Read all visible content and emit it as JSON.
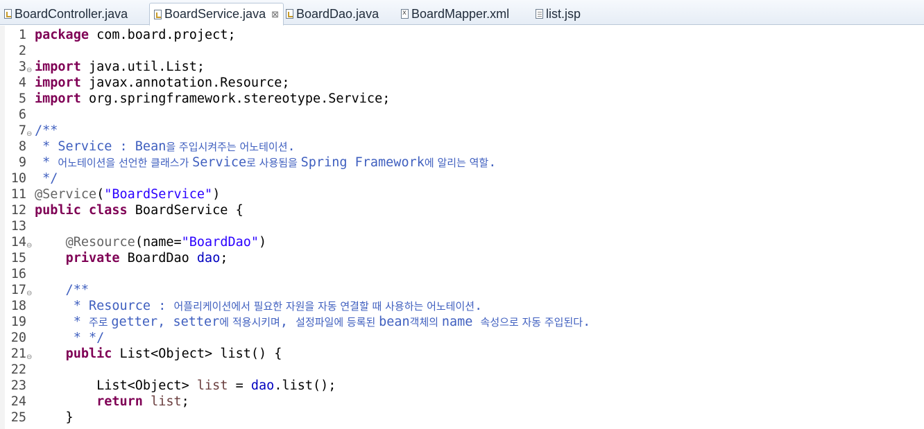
{
  "tabs": [
    {
      "label": "BoardController.java",
      "icon": "java-file-icon",
      "active": false
    },
    {
      "label": "BoardService.java",
      "icon": "java-file-icon",
      "active": true
    },
    {
      "label": "BoardDao.java",
      "icon": "java-file-icon",
      "active": false
    },
    {
      "label": "BoardMapper.xml",
      "icon": "xml-file-icon",
      "active": false
    },
    {
      "label": "list.jsp",
      "icon": "jsp-file-icon",
      "active": false
    }
  ],
  "close_glyph": "⊠",
  "fold_glyph": "⊖",
  "lines": [
    {
      "n": "1",
      "fold": false,
      "t": [
        {
          "c": "kw",
          "s": "package"
        },
        {
          "c": "plain",
          "s": " com.board.project;"
        }
      ]
    },
    {
      "n": "2",
      "fold": false,
      "t": []
    },
    {
      "n": "3",
      "fold": true,
      "t": [
        {
          "c": "kw",
          "s": "import"
        },
        {
          "c": "plain",
          "s": " java.util.List;"
        }
      ]
    },
    {
      "n": "4",
      "fold": false,
      "t": [
        {
          "c": "kw",
          "s": "import"
        },
        {
          "c": "plain",
          "s": " javax.annotation.Resource;"
        }
      ]
    },
    {
      "n": "5",
      "fold": false,
      "t": [
        {
          "c": "kw",
          "s": "import"
        },
        {
          "c": "plain",
          "s": " org.springframework.stereotype.Service;"
        }
      ]
    },
    {
      "n": "6",
      "fold": false,
      "t": []
    },
    {
      "n": "7",
      "fold": true,
      "t": [
        {
          "c": "jdoc",
          "s": "/**"
        }
      ]
    },
    {
      "n": "8",
      "fold": false,
      "t": [
        {
          "c": "jdoc",
          "s": " * Service : Bean"
        },
        {
          "c": "jdoc ko",
          "s": "을 주입시켜주는 어노테이션"
        },
        {
          "c": "jdoc",
          "s": "."
        }
      ]
    },
    {
      "n": "9",
      "fold": false,
      "t": [
        {
          "c": "jdoc",
          "s": " * "
        },
        {
          "c": "jdoc ko",
          "s": "어노테이션을 선언한 클래스가 "
        },
        {
          "c": "jdoc",
          "s": "Service"
        },
        {
          "c": "jdoc ko",
          "s": "로 사용됨을 "
        },
        {
          "c": "jdoc",
          "s": "Spring Framework"
        },
        {
          "c": "jdoc ko",
          "s": "에 알리는 역할"
        },
        {
          "c": "jdoc",
          "s": "."
        }
      ]
    },
    {
      "n": "10",
      "fold": false,
      "t": [
        {
          "c": "jdoc",
          "s": " */"
        }
      ]
    },
    {
      "n": "11",
      "fold": false,
      "t": [
        {
          "c": "ann",
          "s": "@Service"
        },
        {
          "c": "plain",
          "s": "("
        },
        {
          "c": "str",
          "s": "\"BoardService\""
        },
        {
          "c": "plain",
          "s": ")"
        }
      ]
    },
    {
      "n": "12",
      "fold": false,
      "t": [
        {
          "c": "kw",
          "s": "public class"
        },
        {
          "c": "plain",
          "s": " BoardService {"
        }
      ]
    },
    {
      "n": "13",
      "fold": false,
      "t": []
    },
    {
      "n": "14",
      "fold": true,
      "t": [
        {
          "c": "plain",
          "s": "    "
        },
        {
          "c": "ann",
          "s": "@Resource"
        },
        {
          "c": "plain",
          "s": "(name="
        },
        {
          "c": "str",
          "s": "\"BoardDao\""
        },
        {
          "c": "plain",
          "s": ")"
        }
      ]
    },
    {
      "n": "15",
      "fold": false,
      "t": [
        {
          "c": "plain",
          "s": "    "
        },
        {
          "c": "kw",
          "s": "private"
        },
        {
          "c": "plain",
          "s": " BoardDao "
        },
        {
          "c": "field",
          "s": "dao"
        },
        {
          "c": "plain",
          "s": ";"
        }
      ]
    },
    {
      "n": "16",
      "fold": false,
      "t": []
    },
    {
      "n": "17",
      "fold": true,
      "t": [
        {
          "c": "jdoc",
          "s": "    /**"
        }
      ]
    },
    {
      "n": "18",
      "fold": false,
      "t": [
        {
          "c": "jdoc",
          "s": "     * Resource : "
        },
        {
          "c": "jdoc ko",
          "s": "어플리케이션에서 필요한 자원을 자동 연결할 때 사용하는 어노테이션"
        },
        {
          "c": "jdoc",
          "s": "."
        }
      ]
    },
    {
      "n": "19",
      "fold": false,
      "t": [
        {
          "c": "jdoc",
          "s": "     * "
        },
        {
          "c": "jdoc ko",
          "s": "주로 "
        },
        {
          "c": "jdoc",
          "s": "getter, setter"
        },
        {
          "c": "jdoc ko",
          "s": "에 적용시키며"
        },
        {
          "c": "jdoc",
          "s": ", "
        },
        {
          "c": "jdoc ko",
          "s": "설정파일에 등록된 "
        },
        {
          "c": "jdoc",
          "s": "bean"
        },
        {
          "c": "jdoc ko",
          "s": "객체의 "
        },
        {
          "c": "jdoc",
          "s": "name "
        },
        {
          "c": "jdoc ko",
          "s": "속성으로 자동 주입된다"
        },
        {
          "c": "jdoc",
          "s": "."
        }
      ]
    },
    {
      "n": "20",
      "fold": false,
      "t": [
        {
          "c": "jdoc",
          "s": "     * */"
        }
      ]
    },
    {
      "n": "21",
      "fold": true,
      "t": [
        {
          "c": "plain",
          "s": "    "
        },
        {
          "c": "kw",
          "s": "public"
        },
        {
          "c": "plain",
          "s": " List<Object> list() {"
        }
      ]
    },
    {
      "n": "22",
      "fold": false,
      "t": []
    },
    {
      "n": "23",
      "fold": false,
      "t": [
        {
          "c": "plain",
          "s": "        List<Object> "
        },
        {
          "c": "local",
          "s": "list"
        },
        {
          "c": "plain",
          "s": " = "
        },
        {
          "c": "field",
          "s": "dao"
        },
        {
          "c": "plain",
          "s": ".list();"
        }
      ]
    },
    {
      "n": "24",
      "fold": false,
      "t": [
        {
          "c": "plain",
          "s": "        "
        },
        {
          "c": "kw",
          "s": "return"
        },
        {
          "c": "plain",
          "s": " "
        },
        {
          "c": "local",
          "s": "list"
        },
        {
          "c": "plain",
          "s": ";"
        }
      ]
    },
    {
      "n": "25",
      "fold": false,
      "t": [
        {
          "c": "plain",
          "s": "    }"
        }
      ]
    }
  ]
}
